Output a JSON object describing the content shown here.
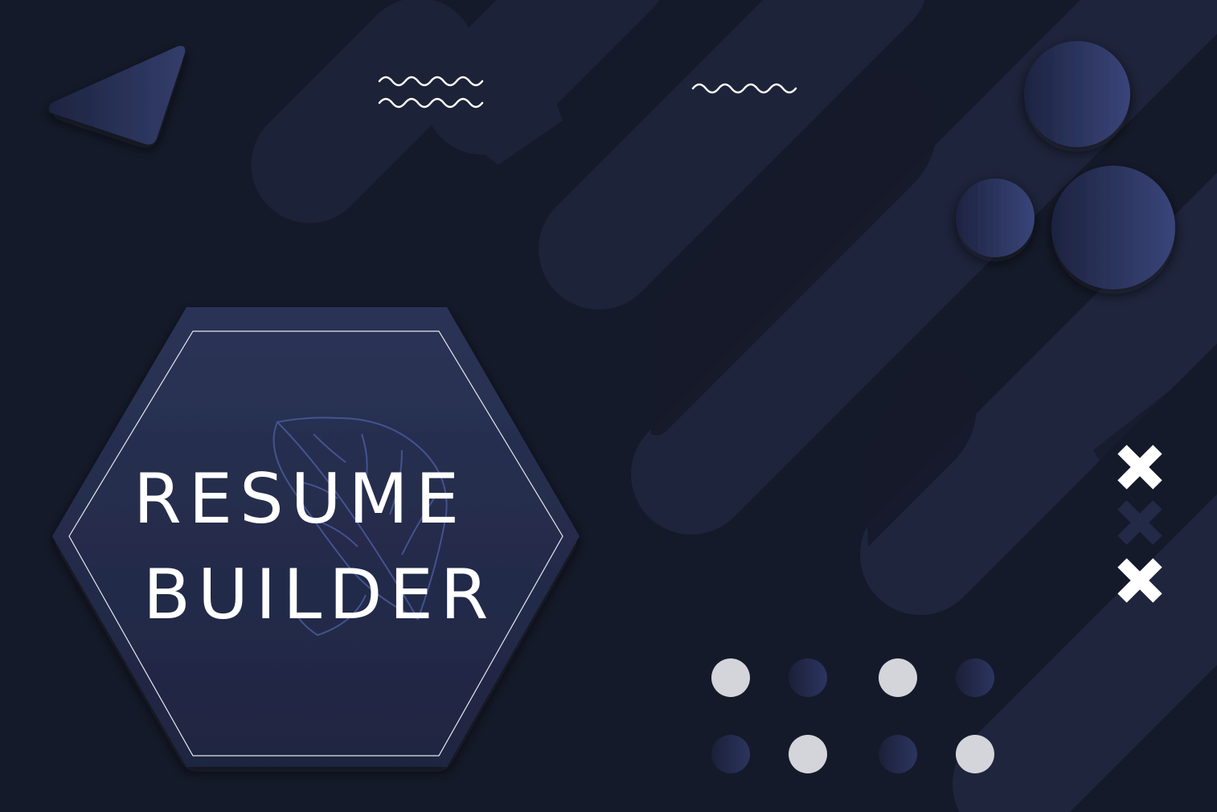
{
  "banner": {
    "title_line_1": "RESUME",
    "title_line_2": "BUILDER",
    "icon": "monstera-leaf-icon"
  },
  "colors": {
    "background": "#151a2a",
    "shape": "#1f2540",
    "accent": "#2f3a66",
    "text": "#ffffff",
    "dot_light": "#d3d5da"
  }
}
